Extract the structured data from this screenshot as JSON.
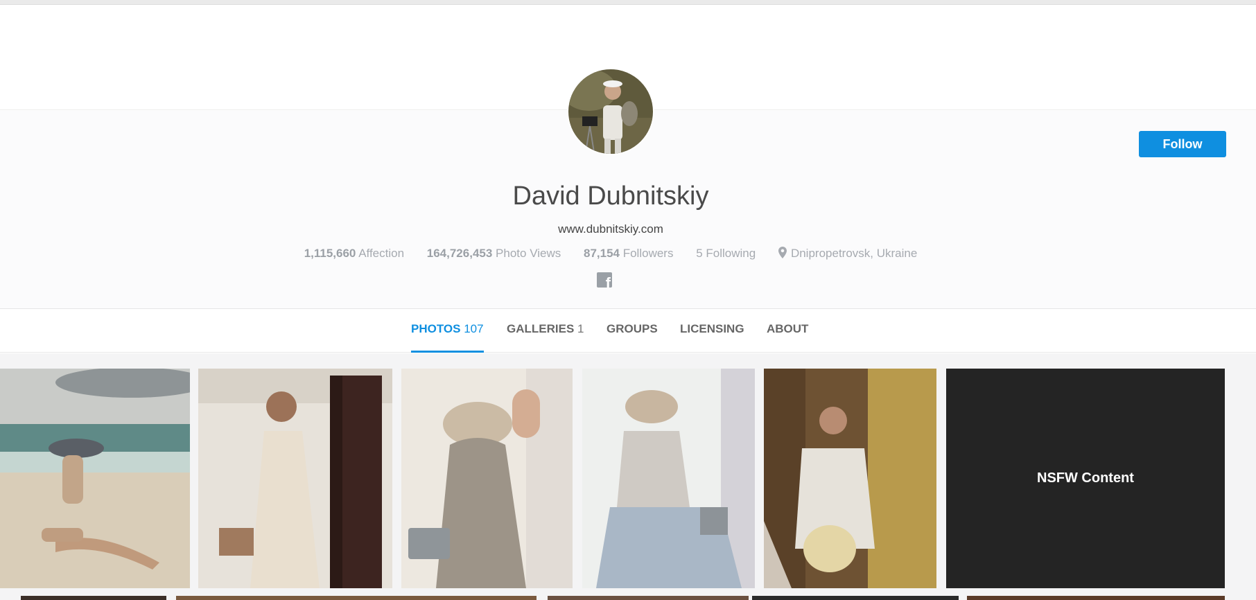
{
  "profile": {
    "name": "David Dubnitskiy",
    "website": "www.dubnitskiy.com",
    "follow_label": "Follow",
    "stats": {
      "affection_value": "1,115,660",
      "affection_label": "Affection",
      "views_value": "164,726,453",
      "views_label": "Photo Views",
      "followers_value": "87,154",
      "followers_label": "Followers",
      "following_value": "5",
      "following_label": "Following",
      "location": "Dnipropetrovsk, Ukraine"
    },
    "social": {
      "icon": "facebook-icon"
    }
  },
  "tabs": [
    {
      "label": "PHOTOS",
      "count": "107",
      "active": true
    },
    {
      "label": "GALLERIES",
      "count": "1"
    },
    {
      "label": "GROUPS",
      "count": ""
    },
    {
      "label": "LICENSING",
      "count": ""
    },
    {
      "label": "ABOUT",
      "count": ""
    }
  ],
  "photos": {
    "nsfw_label": "NSFW Content"
  },
  "colors": {
    "accent": "#0f8fe0",
    "nsfw_bg": "#242424"
  }
}
